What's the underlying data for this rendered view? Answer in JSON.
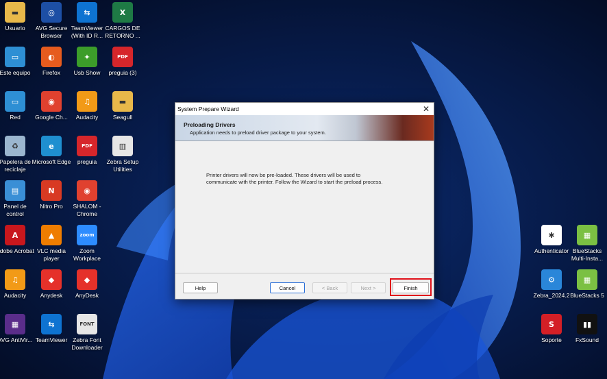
{
  "desktop": {
    "icons_left": [
      {
        "label": "Usuario",
        "icon": "user-folder-icon",
        "color": "#e8b84a"
      },
      {
        "label": "AVG Secure Browser",
        "icon": "avg-browser-icon",
        "color": "#1d4fa5"
      },
      {
        "label": "TeamViewer (With ID R...",
        "icon": "teamviewer-icon",
        "color": "#0e73d1"
      },
      {
        "label": "CARGOS DE RETORNO ...",
        "icon": "excel-icon",
        "color": "#1e7a45"
      },
      {
        "label": "Este equipo",
        "icon": "computer-icon",
        "color": "#2e8fd4"
      },
      {
        "label": "Firefox",
        "icon": "firefox-icon",
        "color": "#e65b1e"
      },
      {
        "label": "Usb Show",
        "icon": "usb-show-icon",
        "color": "#3c9d2a"
      },
      {
        "label": "preguia (3)",
        "icon": "pdf-icon",
        "color": "#d6262b"
      },
      {
        "label": "Red",
        "icon": "network-icon",
        "color": "#2e8fd4"
      },
      {
        "label": "Google Ch...",
        "icon": "chrome-icon",
        "color": "#e0412f"
      },
      {
        "label": "Audacity",
        "icon": "audacity-icon",
        "color": "#f29a17"
      },
      {
        "label": "Seagull",
        "icon": "folder-icon",
        "color": "#e8b84a"
      },
      {
        "label": "Papelera de reciclaje",
        "icon": "recycle-bin-icon",
        "color": "#9bb6cf"
      },
      {
        "label": "Microsoft Edge",
        "icon": "edge-icon",
        "color": "#1f8fd0"
      },
      {
        "label": "preguia",
        "icon": "pdf-icon",
        "color": "#d6262b"
      },
      {
        "label": "Zebra Setup Utilities",
        "icon": "zebra-icon",
        "color": "#e6e6e6"
      },
      {
        "label": "Panel de control",
        "icon": "control-panel-icon",
        "color": "#3a8fd6"
      },
      {
        "label": "Nitro Pro",
        "icon": "nitro-pro-icon",
        "color": "#d83a23"
      },
      {
        "label": "SHALOM - Chrome",
        "icon": "chrome-icon",
        "color": "#e0412f"
      },
      {
        "label": "Adobe Acrobat",
        "icon": "acrobat-icon",
        "color": "#c8171d"
      },
      {
        "label": "VLC media player",
        "icon": "vlc-icon",
        "color": "#ef7d00"
      },
      {
        "label": "Zoom Workplace",
        "icon": "zoom-icon",
        "color": "#2d8cff"
      },
      {
        "label": "Audacity",
        "icon": "audacity-icon",
        "color": "#f29a17"
      },
      {
        "label": "Anydesk",
        "icon": "anydesk-icon",
        "color": "#e5312a"
      },
      {
        "label": "AnyDesk",
        "icon": "anydesk-icon",
        "color": "#e5312a"
      },
      {
        "label": "AVG AntiVir...",
        "icon": "avg-antivirus-icon",
        "color": "#5a2d8a"
      },
      {
        "label": "TeamViewer",
        "icon": "teamviewer-icon",
        "color": "#0e73d1"
      },
      {
        "label": "Zebra Font Downloader",
        "icon": "zebra-font-icon",
        "color": "#e6e6e6"
      }
    ],
    "icons_right": [
      {
        "label": "Authenticator",
        "icon": "authenticator-icon",
        "color": "#ffffff"
      },
      {
        "label": "BlueStacks Multi-Insta...",
        "icon": "bluestacks-icon",
        "color": "#7bc043"
      },
      {
        "label": "Zebra_2024.2",
        "icon": "gear-icon",
        "color": "#2a86d9"
      },
      {
        "label": "BlueStacks 5",
        "icon": "bluestacks-icon",
        "color": "#7bc043"
      },
      {
        "label": "Soporte",
        "icon": "soporte-icon",
        "color": "#d41f26"
      },
      {
        "label": "FxSound",
        "icon": "fxsound-icon",
        "color": "#111111"
      }
    ]
  },
  "dialog": {
    "title": "System Prepare Wizard",
    "banner_heading": "Preloading Drivers",
    "banner_subtitle": "Application needs to preload driver package to your system.",
    "message": "Printer drivers will now be pre-loaded. These drivers will be used to communicate with the printer. Follow the Wizard to start the preload process.",
    "buttons": {
      "help": "Help",
      "cancel": "Cancel",
      "back": "< Back",
      "next": "Next >",
      "finish": "Finish"
    },
    "highlight_color": "#e0111a"
  }
}
